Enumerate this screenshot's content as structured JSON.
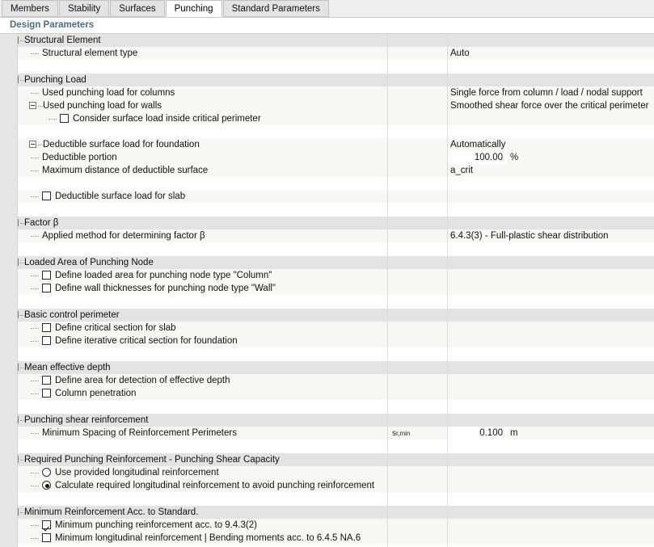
{
  "tabs": [
    {
      "label": "Members",
      "active": false
    },
    {
      "label": "Stability",
      "active": false
    },
    {
      "label": "Surfaces",
      "active": false
    },
    {
      "label": "Punching",
      "active": true
    },
    {
      "label": "Standard Parameters",
      "active": false
    }
  ],
  "panel": {
    "title": "Design Parameters"
  },
  "colors": {
    "accent": "#4a6b8a",
    "group_bg": "#e3e3e3",
    "row_bg": "#f7f8f3",
    "gutter": "#e6e6e6"
  },
  "sections": [
    {
      "name": "structural-element",
      "title": "Structural Element",
      "rows": [
        {
          "kind": "value",
          "label": "Structural element type",
          "value": "Auto"
        }
      ]
    },
    {
      "name": "punching-load",
      "title": "Punching Load",
      "rows": [
        {
          "kind": "value",
          "label": "Used punching load for columns",
          "value": "Single force from column / load / nodal support"
        },
        {
          "kind": "value-expandable",
          "label": "Used punching load for walls",
          "value": "Smoothed shear force over the critical perimeter"
        },
        {
          "kind": "checkbox",
          "label": "Consider surface load inside critical perimeter",
          "checked": false
        },
        {
          "kind": "blank"
        },
        {
          "kind": "value-expandable",
          "label": "Deductible surface load for foundation",
          "value": "Automatically"
        },
        {
          "kind": "number",
          "label": "Deductible portion",
          "number": "100.00",
          "unit": "%"
        },
        {
          "kind": "value",
          "label": "Maximum distance of deductible surface",
          "value": "a_crit"
        },
        {
          "kind": "blank"
        },
        {
          "kind": "checkbox",
          "label": "Deductible surface load for slab",
          "checked": false
        }
      ]
    },
    {
      "name": "factor-beta",
      "title": "Factor β",
      "rows": [
        {
          "kind": "value",
          "label": "Applied method for determining factor β",
          "value": "6.4.3(3) - Full-plastic shear distribution"
        }
      ]
    },
    {
      "name": "loaded-area-of-punching-node",
      "title": "Loaded Area of Punching Node",
      "rows": [
        {
          "kind": "checkbox",
          "label": "Define loaded area for punching node type \"Column\"",
          "checked": false
        },
        {
          "kind": "checkbox",
          "label": "Define wall thicknesses for punching node type \"Wall\"",
          "checked": false
        }
      ]
    },
    {
      "name": "basic-control-perimeter",
      "title": "Basic control perimeter",
      "rows": [
        {
          "kind": "checkbox",
          "label": "Define critical section for slab",
          "checked": false
        },
        {
          "kind": "checkbox",
          "label": "Define iterative critical section for foundation",
          "checked": false
        }
      ]
    },
    {
      "name": "mean-effective-depth",
      "title": "Mean effective depth",
      "rows": [
        {
          "kind": "checkbox",
          "label": "Define area for detection of effective depth",
          "checked": false
        },
        {
          "kind": "checkbox",
          "label": "Column penetration",
          "checked": false
        }
      ]
    },
    {
      "name": "punching-shear-reinforcement",
      "title": "Punching shear reinforcement",
      "rows": [
        {
          "kind": "number",
          "label": "Minimum Spacing of Reinforcement Perimeters",
          "symbol_base": "s",
          "symbol_sub": "r,min",
          "number": "0.100",
          "unit": "m"
        }
      ]
    },
    {
      "name": "required-punching-reinforcement",
      "title": "Required Punching Reinforcement - Punching Shear Capacity",
      "rows": [
        {
          "kind": "radio",
          "label": "Use provided longitudinal reinforcement",
          "selected": false
        },
        {
          "kind": "radio",
          "label": "Calculate required longitudinal reinforcement to avoid punching reinforcement",
          "selected": true
        }
      ]
    },
    {
      "name": "minimum-reinforcement-acc-to-standard",
      "title": "Minimum Reinforcement Acc. to Standard.",
      "rows": [
        {
          "kind": "checkbox",
          "label": "Minimum punching reinforcement acc. to 9.4.3(2)",
          "checked": true
        },
        {
          "kind": "checkbox",
          "label": "Minimum longitudinal reinforcement | Bending moments acc. to 6.4.5 NA.6",
          "checked": false
        }
      ]
    }
  ]
}
